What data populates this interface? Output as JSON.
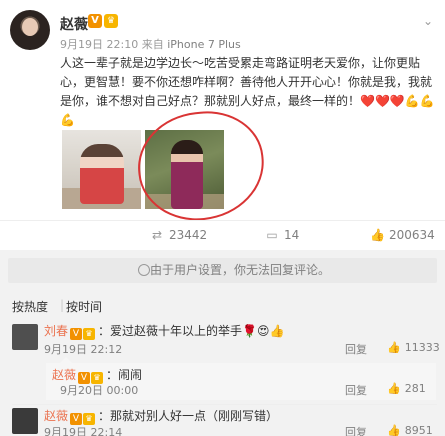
{
  "post": {
    "author": "赵薇",
    "badge_v": "V",
    "badge_crown": "♛",
    "date": "9月19日",
    "time": "22:10",
    "source_prefix": "来自",
    "source": "iPhone 7 Plus",
    "text_main": "人这一辈子就是边学边长～吃苦受累走弯路证明老天爱你，让你更贴心，更智慧！要不你还想咋样啊？善待他人开开心心！你就是我，我就是你，谁不想对自己好点？那就别人好点，最终一样的！",
    "emoji_hearts": "❤️❤️❤️",
    "emoji_arms": "💪💪💪",
    "dropdown_icon": "chevron-down-icon"
  },
  "actions": {
    "repost_count": "23442",
    "comment_count": "14",
    "like_count": "200634"
  },
  "notice": {
    "text": "由于用户设置，你无法回复评论。"
  },
  "sort": {
    "hot": "按热度",
    "separator": "|",
    "time": "按时间"
  },
  "comments": [
    {
      "name": "刘春",
      "text": "：爱过赵薇十年以上的举手",
      "emoji": "🌹😍👍",
      "date": "9月19日",
      "time": "22:12",
      "reply": "回复",
      "likes": "11333"
    },
    {
      "name": "赵薇",
      "text": "：闹闹",
      "date": "9月20日",
      "time": "00:00",
      "reply": "回复",
      "likes": "281"
    },
    {
      "name": "赵薇",
      "text": "：那就对别人好一点（刚刚写错）",
      "date": "9月19日",
      "time": "22:14",
      "reply": "回复",
      "likes": "8951"
    }
  ],
  "colors": {
    "name_link": "#eb7350",
    "annotation_circle": "#d93434",
    "vip_badge": "#f29100"
  }
}
